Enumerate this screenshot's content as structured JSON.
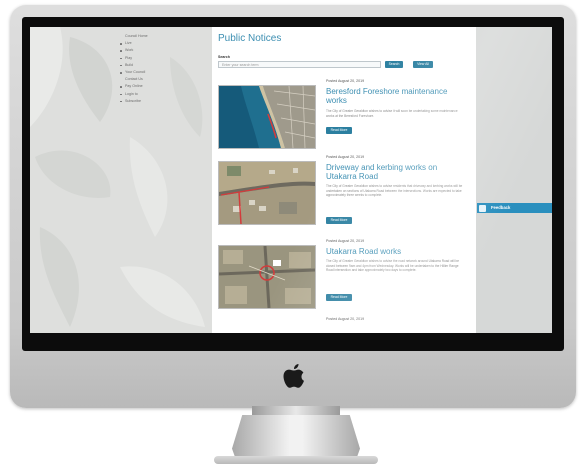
{
  "sidebar": {
    "items": [
      {
        "label": "Council Home",
        "bullet": false
      },
      {
        "label": "Live",
        "bullet": true
      },
      {
        "label": "Work",
        "bullet": true
      },
      {
        "label": "Play",
        "bullet": true
      },
      {
        "label": "Build",
        "bullet": true
      },
      {
        "label": "Your Council",
        "bullet": true
      },
      {
        "label": "Contact Us",
        "bullet": false
      },
      {
        "label": "Pay Online",
        "bullet": true
      },
      {
        "label": "Login to",
        "bullet": true
      },
      {
        "label": "Subscribe",
        "bullet": true
      }
    ]
  },
  "main": {
    "title": "Public Notices",
    "search": {
      "label": "Search",
      "placeholder": "Enter your search term",
      "button": "Search",
      "view_all": "View All"
    },
    "notices": [
      {
        "posted": "Posted August 20, 2019",
        "title": "Beresford Foreshore maintenance works",
        "description": "The City of Greater Geraldton wishes to advise it will soon be undertaking some maintenance works at the Beresford Foreshore.",
        "button": "Read More"
      },
      {
        "posted": "Posted August 20, 2019",
        "title": "Driveway and kerbing works on Utakarra Road",
        "description": "The City of Greater Geraldton wishes to advise residents that driveway and kerbing works will be undertaken on sections of Utakarra Road between the intersections. Works are expected to take approximately three weeks to complete.",
        "button": "Read More"
      },
      {
        "posted": "Posted August 20, 2019",
        "title": "Utakarra Road works",
        "description": "The City of Greater Geraldton wishes to advise the road network around Utakarra Road will be closed between 9am and 4pm from Wednesday. Works will be undertaken to the Hillier Range Road intersection and take approximately two days to complete.",
        "button": "Read More"
      },
      {
        "posted": "Posted August 20, 2019"
      }
    ]
  },
  "feedback": {
    "label": "Feedback"
  },
  "colors": {
    "accent": "#3d8fb2",
    "button": "#2b7fa0",
    "feedback": "#2a8fbe"
  },
  "icons": {
    "logo": "apple-logo-icon",
    "feedback": "chat-icon"
  }
}
